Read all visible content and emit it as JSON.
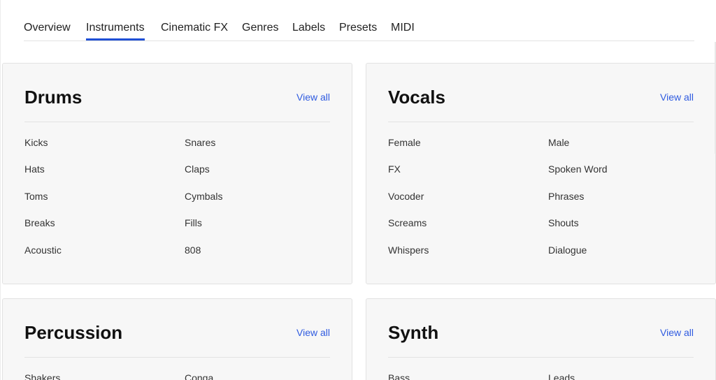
{
  "tabs": [
    {
      "label": "Overview"
    },
    {
      "label": "Instruments"
    },
    {
      "label": "Cinematic FX"
    },
    {
      "label": "Genres"
    },
    {
      "label": "Labels"
    },
    {
      "label": "Presets"
    },
    {
      "label": "MIDI"
    }
  ],
  "active_tab": "Instruments",
  "accent_color": "#1f4fd6",
  "link_color": "#2f5be0",
  "cards": [
    {
      "title": "Drums",
      "view_all": "View all",
      "items": [
        "Kicks",
        "Snares",
        "Hats",
        "Claps",
        "Toms",
        "Cymbals",
        "Breaks",
        "Fills",
        "Acoustic",
        "808"
      ]
    },
    {
      "title": "Vocals",
      "view_all": "View all",
      "items": [
        "Female",
        "Male",
        "FX",
        "Spoken Word",
        "Vocoder",
        "Phrases",
        "Screams",
        "Shouts",
        "Whispers",
        "Dialogue"
      ]
    },
    {
      "title": "Percussion",
      "view_all": "View all",
      "items": [
        "Shakers",
        "Conga"
      ]
    },
    {
      "title": "Synth",
      "view_all": "View all",
      "items": [
        "Bass",
        "Leads"
      ]
    }
  ]
}
